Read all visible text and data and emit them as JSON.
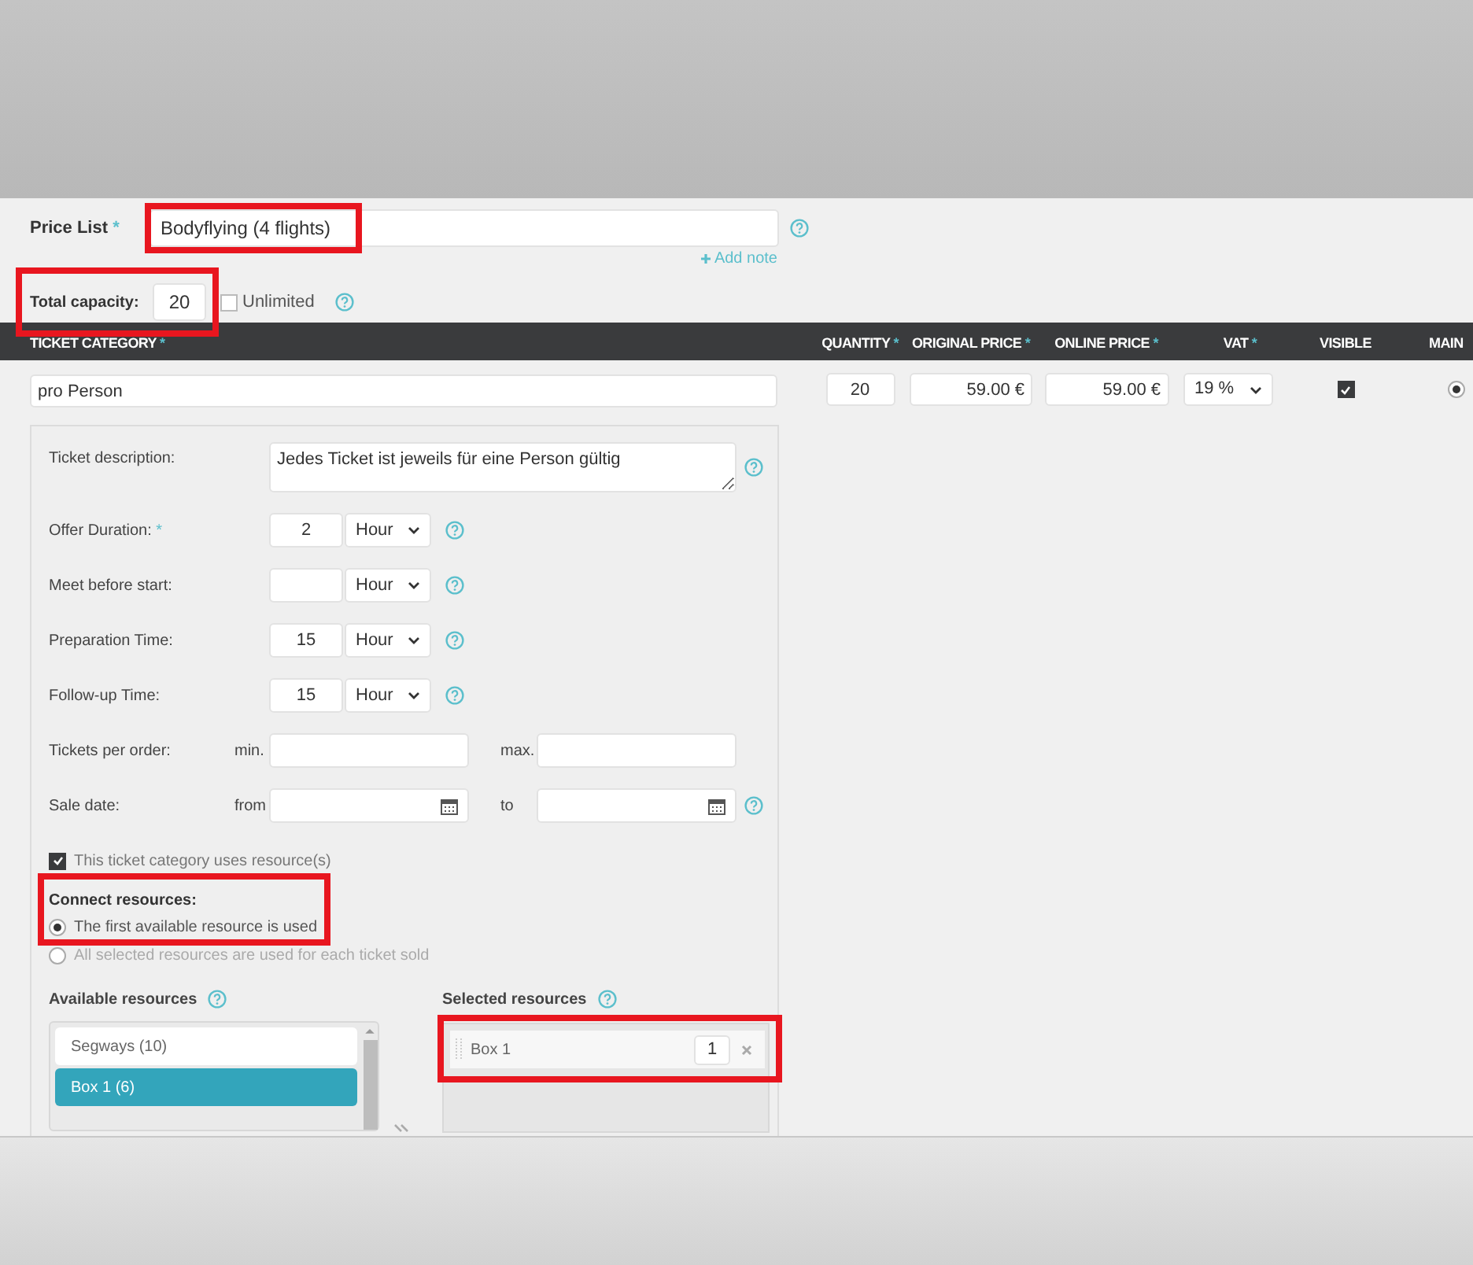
{
  "price_list": {
    "label": "Price List",
    "required_mark": "*",
    "value": "Bodyflying (4 flights)",
    "highlighted": true,
    "add_note": "Add note"
  },
  "total_capacity": {
    "label": "Total capacity:",
    "value": "20",
    "highlighted": true,
    "unlimited": {
      "label": "Unlimited",
      "checked": false
    }
  },
  "table": {
    "columns": [
      {
        "label": "TICKET CATEGORY",
        "required_mark": "*"
      },
      {
        "label": "QUANTITY",
        "required_mark": "*"
      },
      {
        "label": "ORIGINAL PRICE",
        "required_mark": "*"
      },
      {
        "label": "ONLINE PRICE",
        "required_mark": "*"
      },
      {
        "label": "VAT",
        "required_mark": "*"
      },
      {
        "label": "VISIBLE"
      },
      {
        "label": "MAIN"
      }
    ],
    "rows": [
      {
        "category": "pro Person",
        "quantity": "20",
        "original_price": "59.00 €",
        "online_price": "59.00 €",
        "vat": "19 %",
        "visible": true,
        "main": true
      }
    ]
  },
  "details": {
    "fields": [
      {
        "kind": "textarea",
        "label": "Ticket description:",
        "value": "Jedes Ticket ist jeweils für eine Person gültig",
        "help": true
      },
      {
        "kind": "duration",
        "label": "Offer Duration:",
        "required_mark": "*",
        "value": "2",
        "unit": "Hour",
        "help": true
      },
      {
        "kind": "duration",
        "label": "Meet before start:",
        "unit": "Hour",
        "help": true
      },
      {
        "kind": "duration",
        "label": "Preparation Time:",
        "value": "15",
        "unit": "Hour",
        "help": true
      },
      {
        "kind": "duration",
        "label": "Follow-up Time:",
        "value": "15",
        "unit": "Hour",
        "help": true
      },
      {
        "kind": "range",
        "label": "Tickets per order:",
        "from_label": "min.",
        "to_label": "max.",
        "help": false
      },
      {
        "kind": "dates",
        "label": "Sale date:",
        "from_label": "from",
        "to_label": "to",
        "help": true
      }
    ],
    "uses_resources": {
      "label": "This ticket category uses resource(s)",
      "checked": true
    },
    "connect_resources": {
      "label": "Connect resources:",
      "highlighted": true,
      "options": [
        {
          "label": "The first available resource is used",
          "selected": true
        },
        {
          "label": "All selected resources are used for each ticket sold",
          "selected": false
        }
      ]
    },
    "available_resources": {
      "label": "Available resources",
      "items": [
        {
          "label": "Segways (10)",
          "selected": false
        },
        {
          "label": "Box 1 (6)",
          "selected": true
        }
      ]
    },
    "selected_resources": {
      "label": "Selected resources",
      "highlighted": true,
      "items": [
        {
          "label": "Box 1",
          "quantity": "1"
        }
      ]
    }
  }
}
